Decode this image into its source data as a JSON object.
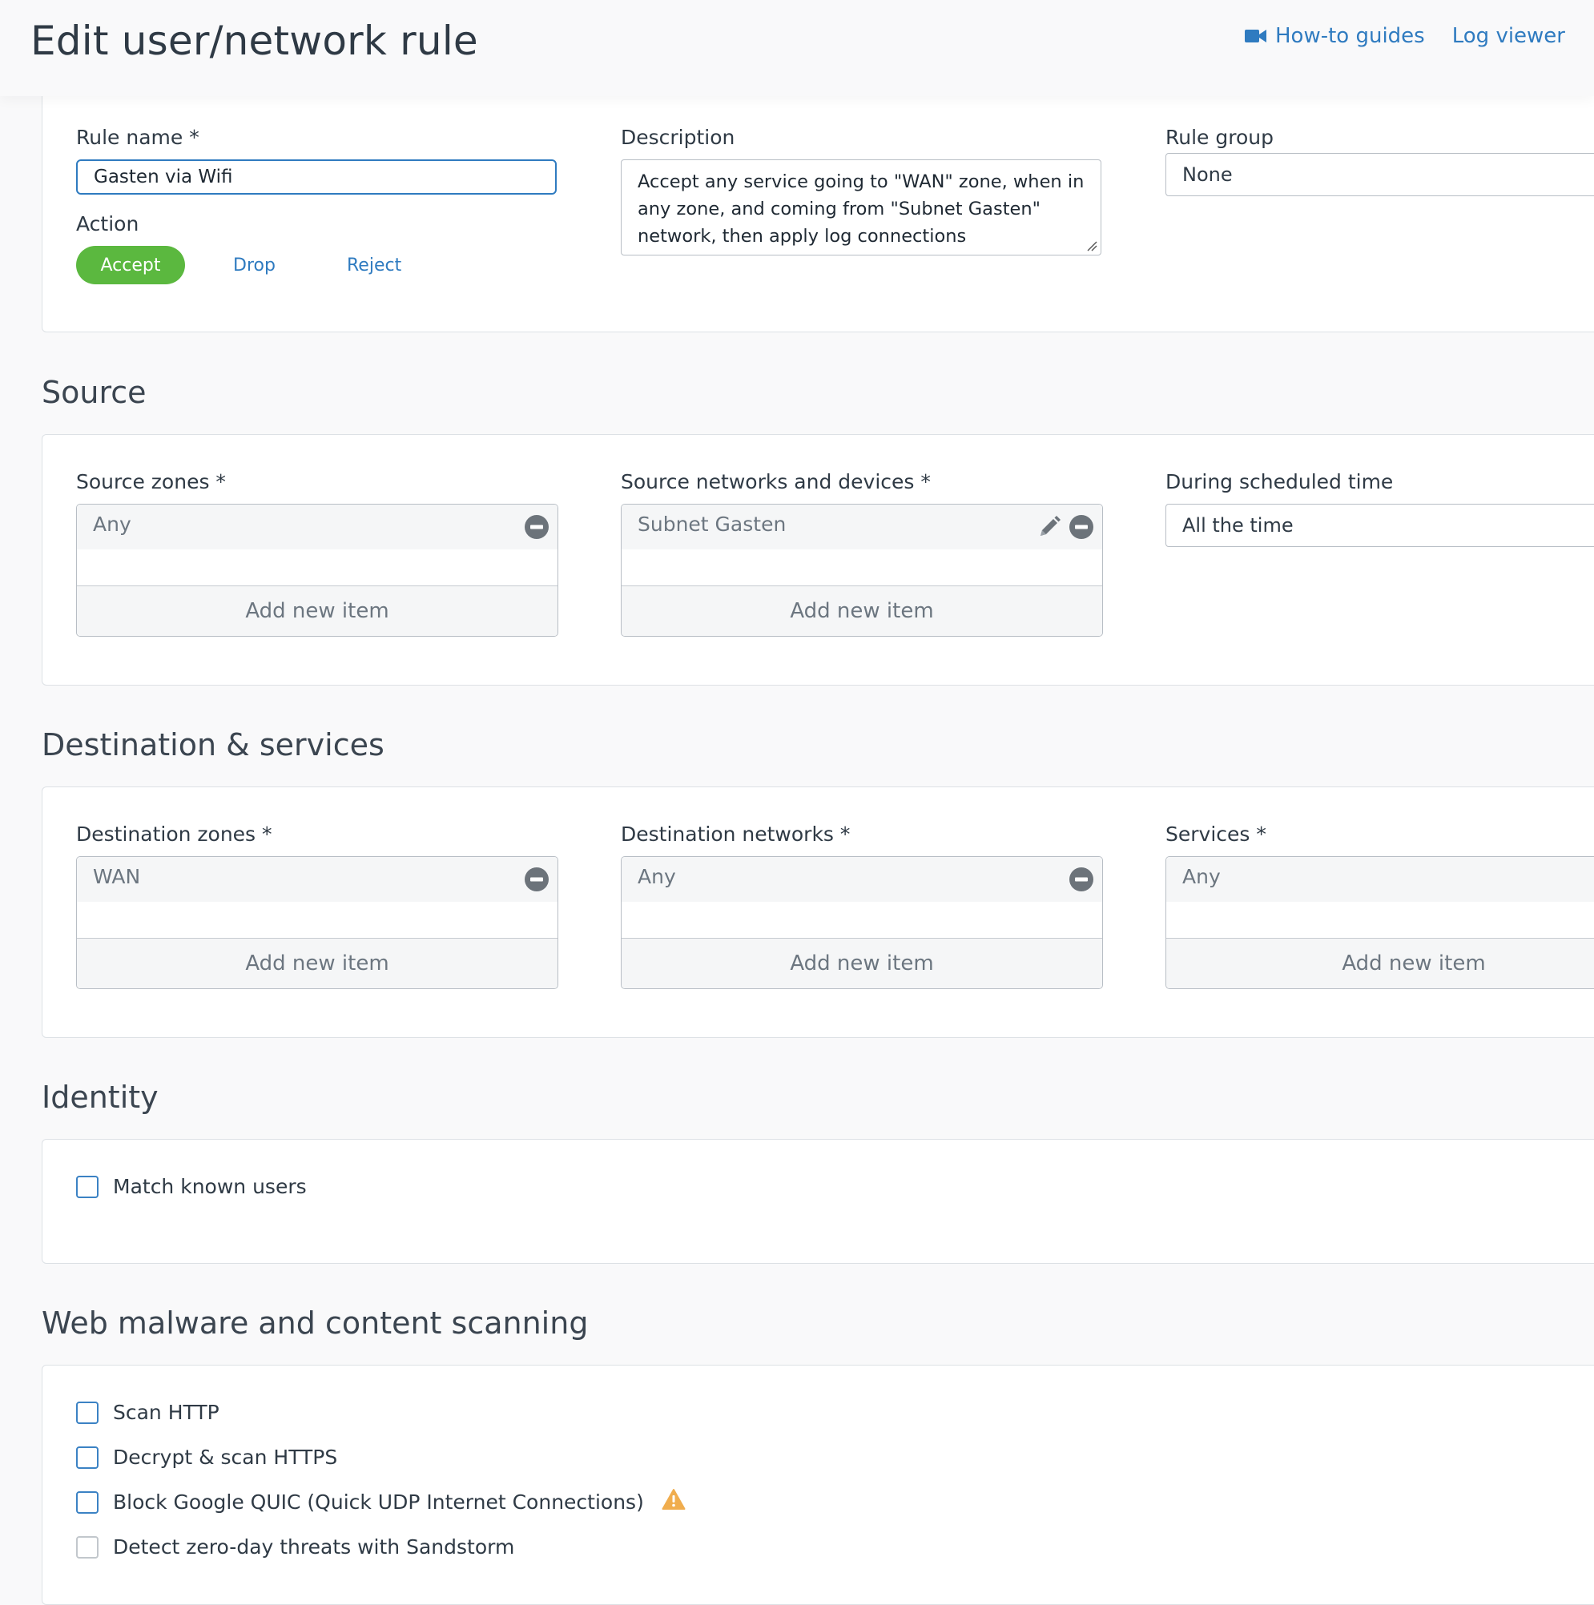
{
  "header": {
    "title": "Edit user/network rule",
    "links": {
      "howto": "How-to guides",
      "logviewer": "Log viewer"
    },
    "icons": {
      "howto": "video-camera-icon"
    }
  },
  "general": {
    "rule_name_label": "Rule name *",
    "rule_name_value": "Gasten via Wifi",
    "description_label": "Description",
    "description_value": "Accept any service going to \"WAN\" zone, when in any zone, and coming from \"Subnet Gasten\" network, then apply log connections",
    "rule_group_label": "Rule group",
    "rule_group_value": "None",
    "action_label": "Action",
    "actions": {
      "accept": "Accept",
      "drop": "Drop",
      "reject": "Reject"
    },
    "selected_action": "Accept"
  },
  "source": {
    "title": "Source",
    "zones_label": "Source zones *",
    "zones_items": [
      "Any"
    ],
    "networks_label": "Source networks and devices *",
    "networks_items": [
      "Subnet Gasten"
    ],
    "schedule_label": "During scheduled time",
    "schedule_value": "All the time",
    "add_item": "Add new item"
  },
  "destination": {
    "title": "Destination & services",
    "zones_label": "Destination zones *",
    "zones_items": [
      "WAN"
    ],
    "networks_label": "Destination networks *",
    "networks_items": [
      "Any"
    ],
    "services_label": "Services *",
    "services_items": [
      "Any"
    ],
    "add_item": "Add new item"
  },
  "identity": {
    "title": "Identity",
    "match_known_users": "Match known users"
  },
  "scanning": {
    "title": "Web malware and content scanning",
    "options": [
      "Scan HTTP",
      "Decrypt & scan HTTPS",
      "Block Google QUIC (Quick UDP Internet Connections)",
      "Detect zero-day threats with Sandstorm"
    ]
  },
  "colors": {
    "accent": "#2f7bc0",
    "accept_green": "#5bb83f",
    "warning": "#f0ad4e"
  }
}
